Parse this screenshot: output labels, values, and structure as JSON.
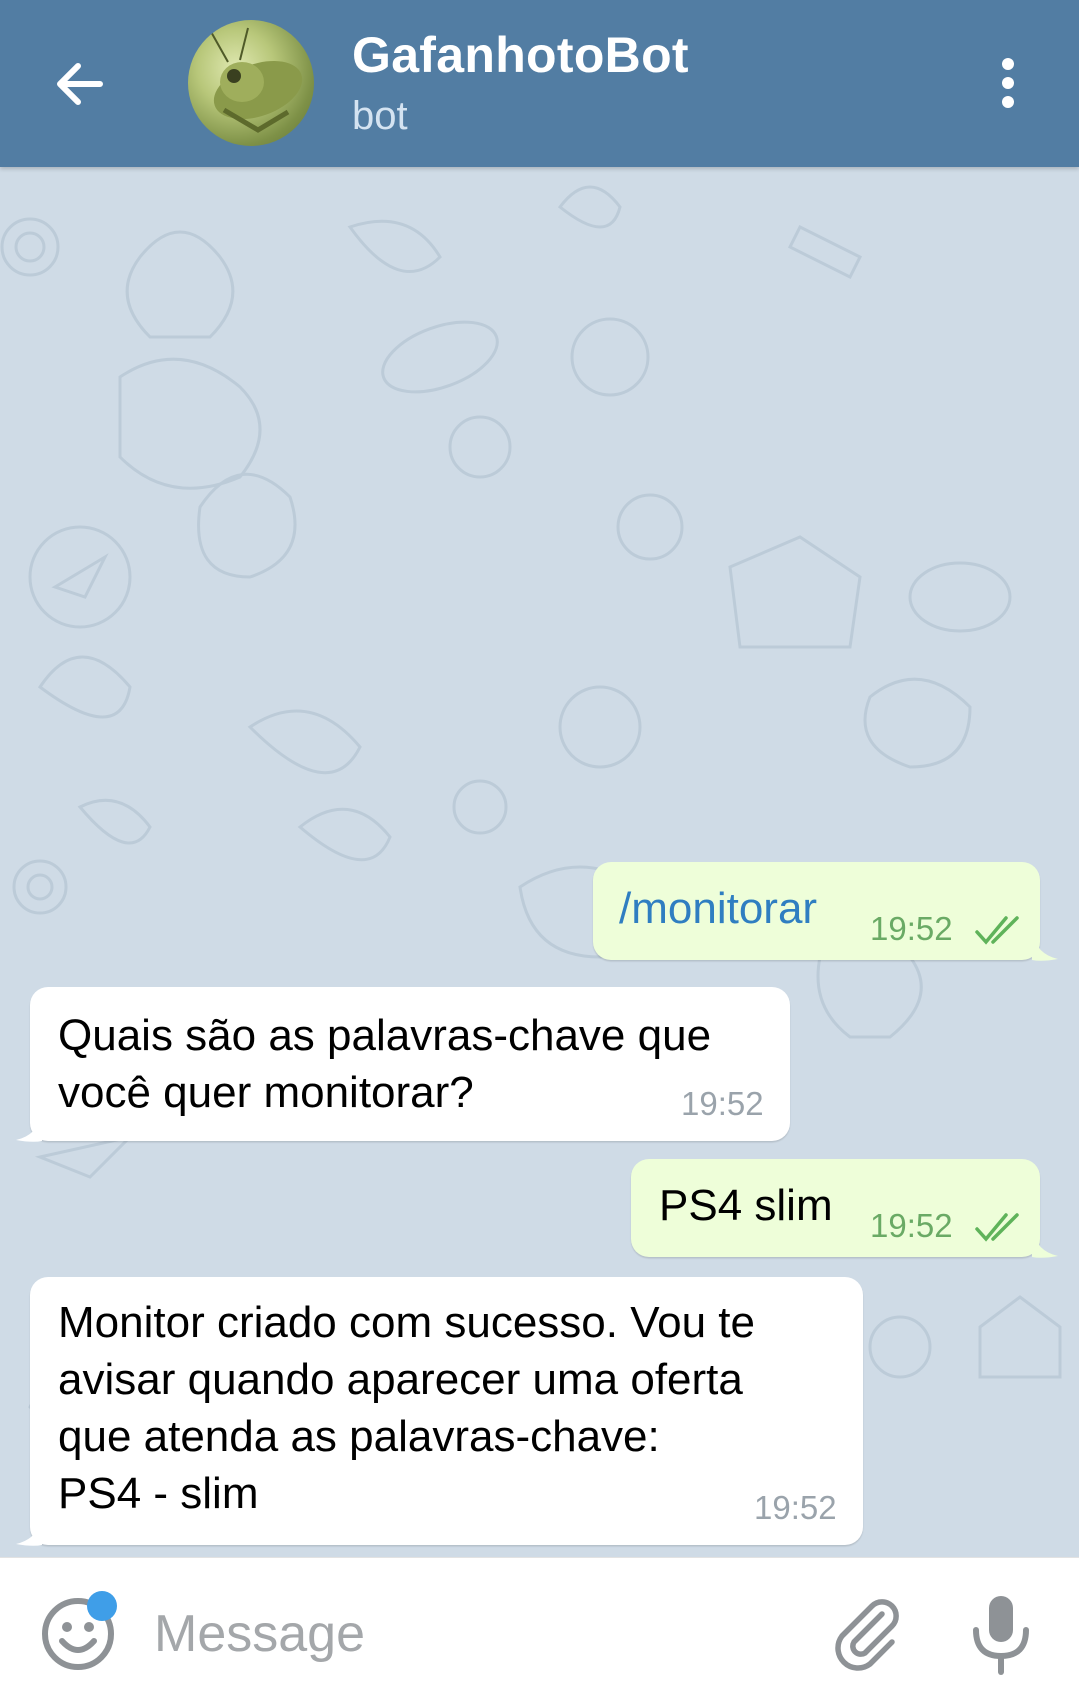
{
  "header": {
    "title": "GafanhotoBot",
    "subtitle": "bot",
    "icons": {
      "back": "arrow-left-icon",
      "menu": "more-vertical-icon",
      "avatar": "grasshopper-avatar"
    }
  },
  "messages": [
    {
      "direction": "out",
      "text": "/monitorar",
      "time": "19:52",
      "status": "read"
    },
    {
      "direction": "in",
      "text": "Quais são as palavras-chave que\nvocê quer monitorar?",
      "time": "19:52"
    },
    {
      "direction": "out",
      "text": "PS4 slim",
      "time": "19:52",
      "status": "read"
    },
    {
      "direction": "in",
      "text": "Monitor criado com sucesso. Vou te\navisar quando aparecer uma oferta\nque atenda as palavras-chave:\nPS4 - slim",
      "time": "19:52"
    }
  ],
  "composer": {
    "placeholder": "Message",
    "value": "",
    "icons": {
      "emoji": "emoji-icon",
      "attach": "paperclip-icon",
      "mic": "microphone-icon"
    }
  },
  "colors": {
    "header_bg": "#527da3",
    "chat_bg": "#cfdbe6",
    "outgoing_bubble": "#eefed9",
    "incoming_bubble": "#ffffff",
    "command_text": "#2f7ec1",
    "outgoing_time": "#6aaa65",
    "notification_dot": "#3f9ee8"
  }
}
